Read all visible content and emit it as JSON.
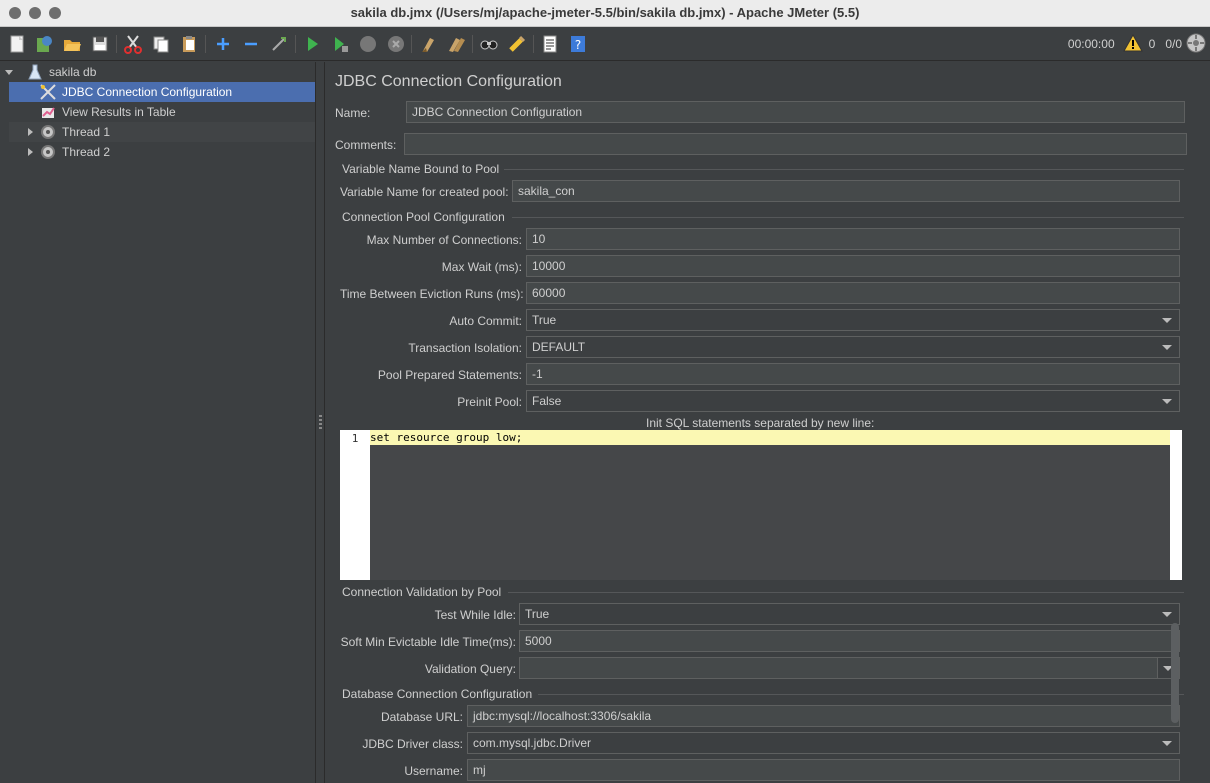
{
  "window": {
    "title": "sakila db.jmx (/Users/mj/apache-jmeter-5.5/bin/sakila db.jmx) - Apache JMeter (5.5)"
  },
  "toolbar": {
    "timer": "00:00:00",
    "warnings": "0",
    "threads": "0/0",
    "icons": [
      "new-icon",
      "templates-icon",
      "open-icon",
      "save-icon",
      "cut-icon",
      "copy-icon",
      "paste-icon",
      "expand-icon",
      "collapse-icon",
      "toggle-icon",
      "start-icon",
      "start-no-pause-icon",
      "stop-icon",
      "shutdown-icon",
      "clear-icon",
      "clear-all-icon",
      "search-icon",
      "reset-search-icon",
      "function-helper-icon",
      "help-icon"
    ]
  },
  "tree": {
    "root": "sakila db",
    "items": [
      {
        "label": "JDBC Connection Configuration",
        "icon": "jdbc-config-icon",
        "selected": true
      },
      {
        "label": "View Results in Table",
        "icon": "results-table-icon"
      },
      {
        "label": "Thread 1",
        "icon": "thread-group-icon"
      },
      {
        "label": "Thread 2",
        "icon": "thread-group-icon"
      }
    ]
  },
  "panel": {
    "title": "JDBC Connection Configuration",
    "name_label": "Name:",
    "name_value": "JDBC Connection Configuration",
    "comments_label": "Comments:",
    "comments_value": "",
    "var_section": "Variable Name Bound to Pool",
    "var_label": "Variable Name for created pool:",
    "var_value": "sakila_con",
    "pool_section": "Connection Pool Configuration",
    "max_conn_label": "Max Number of Connections:",
    "max_conn_value": "10",
    "max_wait_label": "Max Wait (ms):",
    "max_wait_value": "10000",
    "eviction_label": "Time Between Eviction Runs (ms):",
    "eviction_value": "60000",
    "auto_commit_label": "Auto Commit:",
    "auto_commit_value": "True",
    "tx_label": "Transaction Isolation:",
    "tx_value": "DEFAULT",
    "pool_prep_label": "Pool Prepared Statements:",
    "pool_prep_value": "-1",
    "preinit_label": "Preinit Pool:",
    "preinit_value": "False",
    "init_sql_label": "Init SQL statements separated by new line:",
    "init_sql_line_no": "1",
    "init_sql_code": "set resource group low;",
    "validation_section": "Connection Validation by Pool",
    "test_idle_label": "Test While Idle:",
    "test_idle_value": "True",
    "soft_min_label": "Soft Min Evictable Idle Time(ms):",
    "soft_min_value": "5000",
    "validation_query_label": "Validation Query:",
    "validation_query_value": "",
    "db_section": "Database Connection Configuration",
    "db_url_label": "Database URL:",
    "db_url_value": "jdbc:mysql://localhost:3306/sakila",
    "driver_label": "JDBC Driver class:",
    "driver_value": "com.mysql.jdbc.Driver",
    "username_label": "Username:",
    "username_value": "mj"
  }
}
